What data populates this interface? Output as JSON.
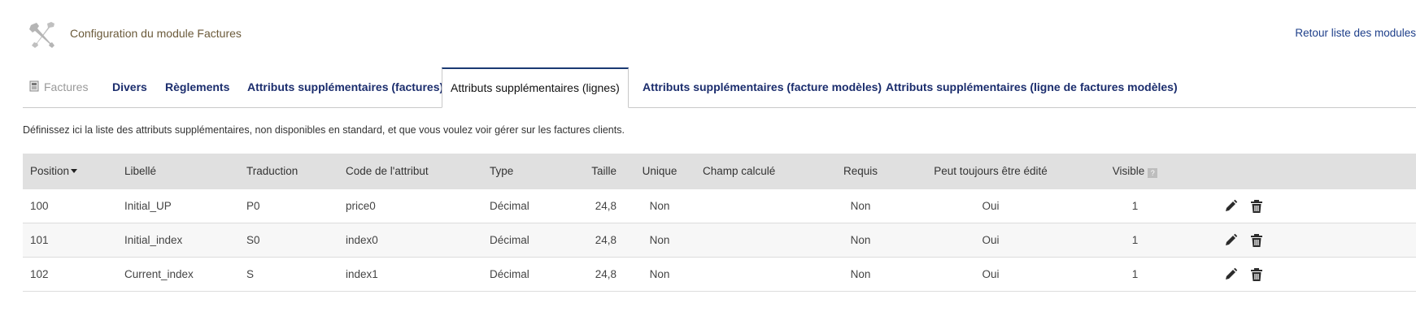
{
  "header": {
    "title": "Configuration du module Factures",
    "back_link": "Retour liste des modules",
    "icon": "tools-icon"
  },
  "tabs": [
    {
      "label": "Factures",
      "icon": "document-icon",
      "active": false
    },
    {
      "label": "Divers",
      "active": false
    },
    {
      "label": "Règlements",
      "active": false
    },
    {
      "label": "Attributs supplémentaires (factures)",
      "active": false
    },
    {
      "label": "Attributs supplémentaires (lignes)",
      "active": true
    },
    {
      "label": "Attributs supplémentaires (facture modèles)",
      "active": false
    },
    {
      "label": "Attributs supplémentaires (ligne de factures modèles)",
      "active": false
    }
  ],
  "intro": "Définissez ici la liste des attributs supplémentaires, non disponibles en standard, et que vous voulez voir gérer sur les factures clients.",
  "table": {
    "columns": {
      "position": "Position",
      "libelle": "Libellé",
      "traduction": "Traduction",
      "code": "Code de l'attribut",
      "type": "Type",
      "taille": "Taille",
      "unique": "Unique",
      "calcule": "Champ calculé",
      "requis": "Requis",
      "editable": "Peut toujours être édité",
      "visible": "Visible",
      "help_glyph": "?"
    },
    "rows": [
      {
        "position": "100",
        "libelle": "Initial_UP",
        "traduction": "P0",
        "code": "price0",
        "type": "Décimal",
        "taille": "24,8",
        "unique": "Non",
        "calcule": "",
        "requis": "Non",
        "editable": "Oui",
        "visible": "1"
      },
      {
        "position": "101",
        "libelle": "Initial_index",
        "traduction": "S0",
        "code": "index0",
        "type": "Décimal",
        "taille": "24,8",
        "unique": "Non",
        "calcule": "",
        "requis": "Non",
        "editable": "Oui",
        "visible": "1"
      },
      {
        "position": "102",
        "libelle": "Current_index",
        "traduction": "S",
        "code": "index1",
        "type": "Décimal",
        "taille": "24,8",
        "unique": "Non",
        "calcule": "",
        "requis": "Non",
        "editable": "Oui",
        "visible": "1"
      }
    ],
    "row_actions": [
      "edit-icon",
      "delete-icon"
    ]
  },
  "colors": {
    "tab_text": "#1b2d6d",
    "link": "#1e3f8a",
    "header_bg": "#e0e0e0",
    "active_tab_border": "#1b3a73"
  }
}
